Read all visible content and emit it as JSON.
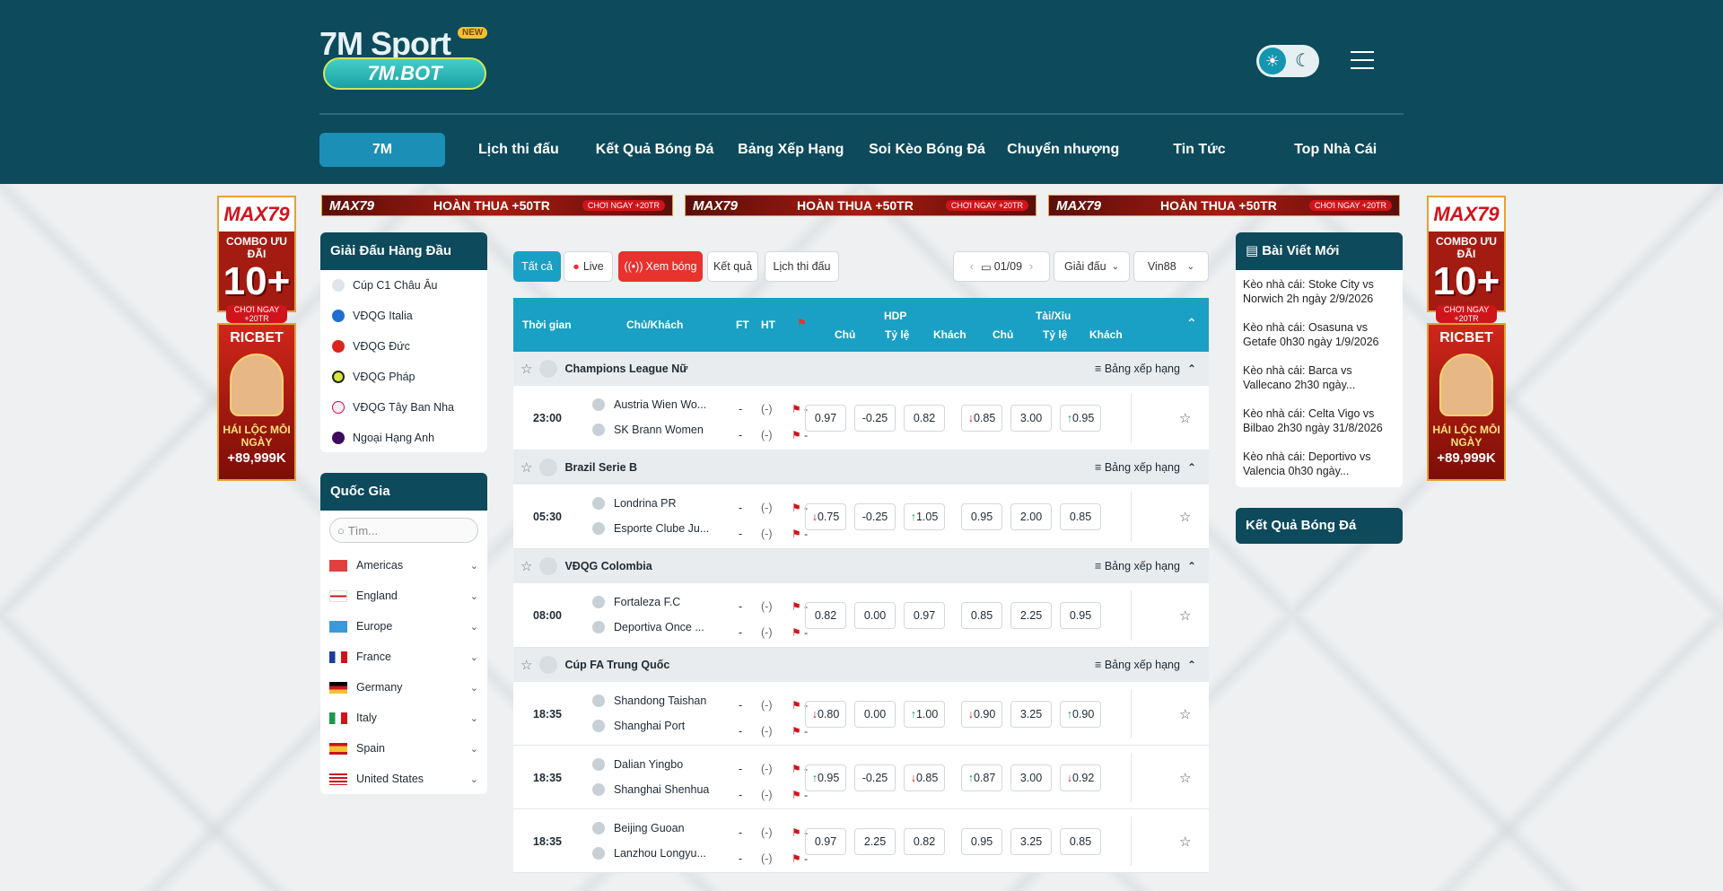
{
  "brand": {
    "logo_top": "7M Sport",
    "logo_badge": "NEW",
    "logo_domain": "7M.BOT"
  },
  "nav": [
    "7M",
    "Lịch thi đấu",
    "Kết Quả Bóng Đá",
    "Bảng Xếp Hạng",
    "Soi Kèo Bóng Đá",
    "Chuyển nhượng",
    "Tin Tức",
    "Top Nhà Cái"
  ],
  "ads": {
    "side_brand": "MAX79",
    "side_combo": "COMBO ƯU ĐÃI",
    "side_big": "10+",
    "side_small": "CHƠI NGAY +20TR",
    "ric_brand": "RICBET",
    "ric_line": "HÁI LỘC MỖI NGÀY",
    "ric_amount": "+89,999K",
    "banner_brand": "MAX79",
    "banner_text": "HOÀN THUA +50TR",
    "banner_cta": "CHƠI NGAY +20TR"
  },
  "leagues_panel": {
    "title": "Giải Đấu Hàng Đầu",
    "items": [
      "Cúp C1 Châu Âu",
      "VĐQG Italia",
      "VĐQG Đức",
      "VĐQG Pháp",
      "VĐQG Tây Ban Nha",
      "Ngoại Hạng Anh"
    ]
  },
  "country_panel": {
    "title": "Quốc Gia",
    "search_placeholder": "Tìm...",
    "items": [
      "Americas",
      "England",
      "Europe",
      "France",
      "Germany",
      "Italy",
      "Spain",
      "United States"
    ]
  },
  "filters": {
    "all": "Tất cả",
    "live": "Live",
    "watch": "Xem bóng",
    "result": "Kết quả",
    "schedule": "Lịch thi đấu",
    "date": "01/09",
    "league": "Giải đấu",
    "bookmaker": "Vin88"
  },
  "table_head": {
    "time": "Thời gian",
    "teams": "Chủ/Khách",
    "ft": "FT",
    "ht": "HT",
    "hdp": "HDP",
    "tx": "Tài/Xỉu",
    "home": "Chủ",
    "ratio": "Tỷ lệ",
    "away": "Khách"
  },
  "standings_label": "Bảng xếp hạng",
  "groups": [
    {
      "name": "Champions League Nữ",
      "matches": [
        {
          "time": "23:00",
          "home": "Austria Wien Wo...",
          "away": "SK Brann Women",
          "odds": [
            "0.97",
            "-0.25",
            "0.82",
            "0.85",
            "3.00",
            "0.95"
          ],
          "arrows": [
            "",
            "",
            "",
            "dn",
            "",
            "up"
          ]
        }
      ]
    },
    {
      "name": "Brazil Serie B",
      "matches": [
        {
          "time": "05:30",
          "home": "Londrina PR",
          "away": "Esporte Clube Ju...",
          "odds": [
            "0.75",
            "-0.25",
            "1.05",
            "0.95",
            "2.00",
            "0.85"
          ],
          "arrows": [
            "dn",
            "",
            "up",
            "",
            "",
            ""
          ]
        }
      ]
    },
    {
      "name": "VĐQG Colombia",
      "matches": [
        {
          "time": "08:00",
          "home": "Fortaleza F.C",
          "away": "Deportiva Once ...",
          "odds": [
            "0.82",
            "0.00",
            "0.97",
            "0.85",
            "2.25",
            "0.95"
          ],
          "arrows": [
            "",
            "",
            "",
            "",
            "",
            ""
          ]
        }
      ]
    },
    {
      "name": "Cúp FA Trung Quốc",
      "matches": [
        {
          "time": "18:35",
          "home": "Shandong Taishan",
          "away": "Shanghai Port",
          "odds": [
            "0.80",
            "0.00",
            "1.00",
            "0.90",
            "3.25",
            "0.90"
          ],
          "arrows": [
            "dn",
            "",
            "up",
            "dn",
            "",
            "up"
          ]
        },
        {
          "time": "18:35",
          "home": "Dalian Yingbo",
          "away": "Shanghai Shenhua",
          "odds": [
            "0.95",
            "-0.25",
            "0.85",
            "0.87",
            "3.00",
            "0.92"
          ],
          "arrows": [
            "up",
            "",
            "dn",
            "up",
            "",
            "dn"
          ]
        },
        {
          "time": "18:35",
          "home": "Beijing Guoan",
          "away": "Lanzhou Longyu...",
          "odds": [
            "0.97",
            "2.25",
            "0.82",
            "0.95",
            "3.25",
            "0.85"
          ],
          "arrows": [
            "",
            "",
            "",
            "",
            "",
            ""
          ]
        }
      ]
    }
  ],
  "score_dash": "-",
  "score_paren": "(-)",
  "news_panel": {
    "title": "Bài Viết Mới",
    "items": [
      "Kèo nhà cái: Stoke City vs Norwich 2h ngày 2/9/2026",
      "Kèo nhà cái: Osasuna vs Getafe 0h30 ngày 1/9/2026",
      "Kèo nhà cái: Barca vs Vallecano 2h30 ngày...",
      "Kèo nhà cái: Celta Vigo vs Bilbao 2h30 ngày 31/8/2026",
      "Kèo nhà cái: Deportivo vs Valencia 0h30 ngày..."
    ]
  },
  "results_panel": {
    "title": "Kết Quả Bóng Đá"
  },
  "colors": {
    "header": "#0c4a5c",
    "accent": "#1aa0c4",
    "live_red": "#e8322d"
  }
}
